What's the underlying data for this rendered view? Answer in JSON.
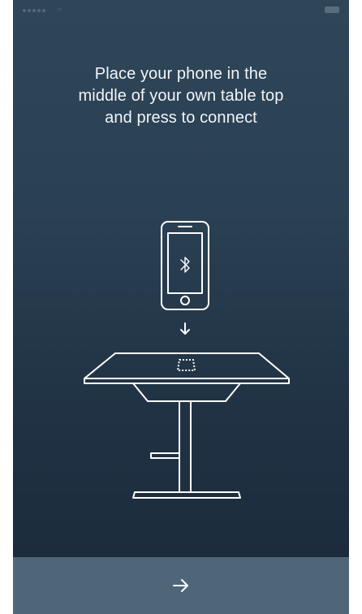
{
  "status_bar": {
    "carrier": "",
    "time": "",
    "battery_icon": "battery-icon",
    "signal_icon": "signal-icon",
    "wifi_icon": "wifi-icon"
  },
  "main": {
    "instruction_line1": "Place your phone in the",
    "instruction_line2": "middle of your own table top",
    "instruction_line3": "and press to connect",
    "illustration": {
      "phone_icon": "phone-icon",
      "bluetooth_icon": "bluetooth-icon",
      "arrow_icon": "arrow-down-icon",
      "table_icon": "table-icon"
    }
  },
  "footer": {
    "next_icon": "arrow-right-icon"
  },
  "colors": {
    "background_top": "#2f4659",
    "background_bottom": "#1a2a3a",
    "footer_bar": "#4f6679",
    "line_art": "#ffffff"
  }
}
